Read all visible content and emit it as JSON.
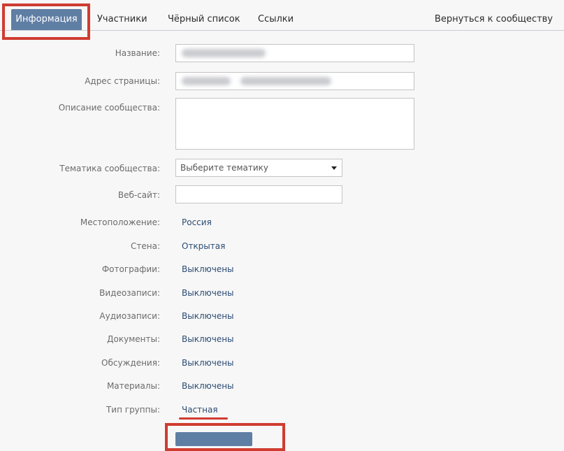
{
  "tabs": {
    "info": "Информация",
    "members": "Участники",
    "blacklist": "Чёрный список",
    "links": "Ссылки",
    "back": "Вернуться к сообществу"
  },
  "form": {
    "name_label": "Название:",
    "address_label": "Адрес страницы:",
    "description_label": "Описание сообщества:",
    "topic_label": "Тематика сообщества:",
    "topic_value": "Выберите тематику",
    "website_label": "Веб-сайт:"
  },
  "settings": [
    {
      "label": "Местоположение:",
      "value": "Россия"
    },
    {
      "label": "Стена:",
      "value": "Открытая"
    },
    {
      "label": "Фотографии:",
      "value": "Выключены"
    },
    {
      "label": "Видеозаписи:",
      "value": "Выключены"
    },
    {
      "label": "Аудиозаписи:",
      "value": "Выключены"
    },
    {
      "label": "Документы:",
      "value": "Выключены"
    },
    {
      "label": "Обсуждения:",
      "value": "Выключены"
    },
    {
      "label": "Материалы:",
      "value": "Выключены"
    },
    {
      "label": "Тип группы:",
      "value": "Частная"
    }
  ],
  "colors": {
    "accent": "#5f7ea4",
    "highlight": "#cf3c30",
    "link": "#2b4b72"
  }
}
